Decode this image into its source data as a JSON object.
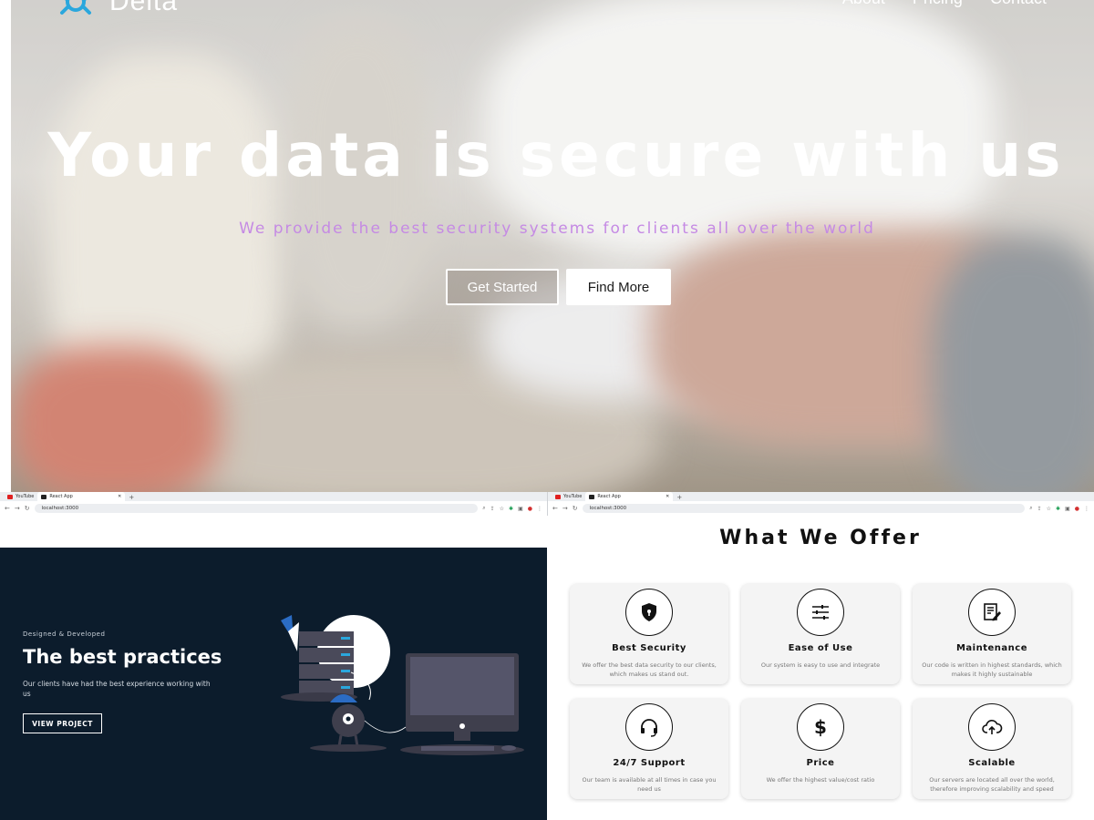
{
  "hero": {
    "brand": "Delta",
    "nav": [
      "About",
      "Pricing",
      "Contact"
    ],
    "title": "Your data is secure with us",
    "subtitle": "We provide the best security systems for clients all over the world",
    "buttons": {
      "primary": "Get Started",
      "secondary": "Find More"
    },
    "colors": {
      "title": "#ffffff",
      "subtitle": "#c58ae4",
      "logo_accent": "#2aa7dd"
    }
  },
  "browser_left": {
    "tabs": [
      {
        "title": "YouTube",
        "icon": "youtube-icon"
      },
      {
        "title": "React App",
        "icon": "react-icon"
      }
    ],
    "address": "localhost:3000"
  },
  "browser_right": {
    "tabs": [
      {
        "title": "YouTube",
        "icon": "youtube-icon"
      },
      {
        "title": "React App",
        "icon": "react-icon"
      }
    ],
    "address": "localhost:3000"
  },
  "practices": {
    "eyebrow": "Designed & Developed",
    "title": "The best practices",
    "description": "Our clients have had the best experience working with us",
    "button": "VIEW PROJECT",
    "background": "#0c1c2c"
  },
  "offer": {
    "heading": "What We Offer",
    "cards": [
      {
        "title": "Best Security",
        "description": "We offer the best data security to our clients, which makes us stand out.",
        "icon": "shield-lock-icon"
      },
      {
        "title": "Ease of Use",
        "description": "Our system is easy to use and integrate",
        "icon": "sliders-icon"
      },
      {
        "title": "Maintenance",
        "description": "Our code is written in highest standards, which makes it highly sustainable",
        "icon": "document-edit-icon"
      },
      {
        "title": "24/7 Support",
        "description": "Our team is available at all times in case you need us",
        "icon": "headset-icon"
      },
      {
        "title": "Price",
        "description": "We offer the highest value/cost ratio",
        "icon": "dollar-icon"
      },
      {
        "title": "Scalable",
        "description": "Our servers are located all over the world, therefore improving scalability and speed",
        "icon": "cloud-upload-icon"
      }
    ]
  }
}
